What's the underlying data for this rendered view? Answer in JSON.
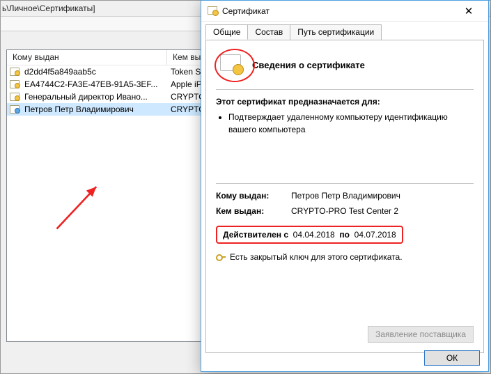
{
  "bg": {
    "path": "ь\\Личное\\Сертификаты]"
  },
  "list": {
    "headers": {
      "issued_to": "Кому выдан",
      "issued_by": "Кем выдан"
    },
    "rows": [
      {
        "to": "d2dd4f5a849aab5c",
        "by": "Token Signin"
      },
      {
        "to": "EA4744C2-FA3E-47EB-91A5-3EF...",
        "by": "Apple iPhone"
      },
      {
        "to": "Генеральный директор Ивано...",
        "by": "CRYPTO-PRO"
      },
      {
        "to": "Петров Петр Владимирович",
        "by": "CRYPTO-PRO"
      }
    ]
  },
  "dialog": {
    "title": "Сертификат",
    "tabs": {
      "general": "Общие",
      "composition": "Состав",
      "path": "Путь сертификации"
    },
    "info_title": "Сведения о сертификате",
    "purpose_title": "Этот сертификат предназначается для:",
    "purpose_item": "Подтверждает удаленному компьютеру идентификацию вашего компьютера",
    "issued_to_label": "Кому выдан:",
    "issued_to_value": "Петров Петр Владимирович",
    "issued_by_label": "Кем выдан:",
    "issued_by_value": "CRYPTO-PRO Test Center 2",
    "valid_from_label": "Действителен с",
    "valid_from": "04.04.2018",
    "valid_to_label": "по",
    "valid_to": "04.07.2018",
    "key_text": "Есть закрытый ключ для этого сертификата.",
    "supplier_btn": "Заявление поставщика",
    "ok": "ОК"
  }
}
